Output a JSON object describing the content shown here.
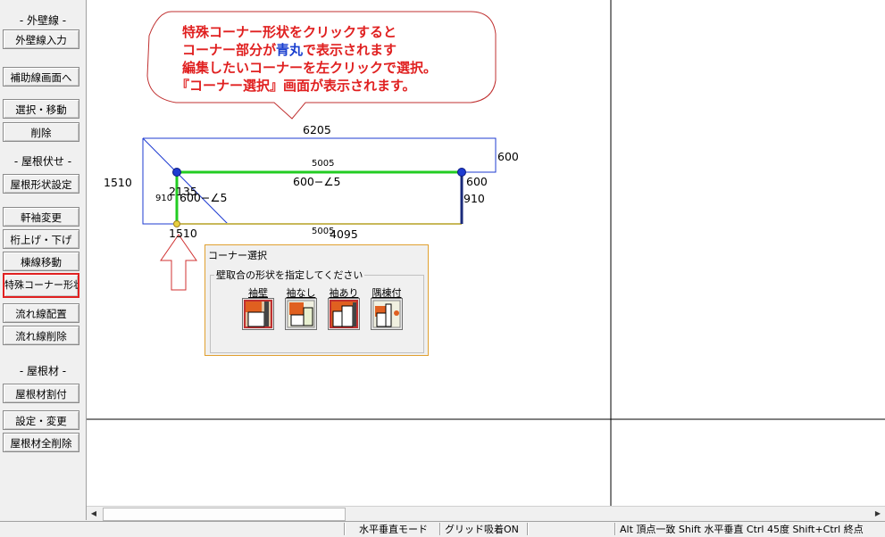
{
  "sidebar": {
    "sections": [
      "- 外壁線 -",
      "- 屋根伏せ -",
      "- 屋根材 -"
    ],
    "buttons": [
      "外壁線入力",
      "補助線画面へ",
      "選択・移動",
      "削除",
      "屋根形状設定",
      "軒袖変更",
      "桁上げ・下げ",
      "棟線移動",
      "特殊コーナー形状",
      "流れ線配置",
      "流れ線削除",
      "屋根材割付",
      "設定・変更",
      "屋根材全削除"
    ]
  },
  "callout": {
    "line1": "特殊コーナー形状をクリックすると",
    "line2_pre": "コーナー部分が",
    "line2_blue": "青丸",
    "line2_post": "で表示されます",
    "line3": "編集したいコーナーを左クリックで選択。",
    "line4": "『コーナー選択』画面が表示されます。"
  },
  "dimensions": {
    "top": "6205",
    "right_upper": "600",
    "left": "1510",
    "inner_top": "5005",
    "inner_mid": "600−∠5",
    "left_2135": "2135",
    "left_910": "910",
    "left_600": "600−∠5",
    "right_600": "600",
    "right_910": "910",
    "bottom_5005": "5005",
    "bottom_4095": "4095",
    "bottom_1510": "1510"
  },
  "dialog": {
    "title": "コーナー選択",
    "group_label": "壁取合の形状を指定してください",
    "options": [
      "袖壁",
      "袖なし",
      "袖あり",
      "隅棟付"
    ]
  },
  "status": {
    "mode": "水平垂直モード",
    "grid": "グリッド吸着ON",
    "hint": "Alt 頂点一致  Shift 水平垂直  Ctrl 45度  Shift+Ctrl 終点"
  },
  "colors": {
    "callout_text": "#e02020",
    "callout_blue": "#1a3fcf",
    "green_line": "#22cc22",
    "blue_line": "#1e3bd1"
  }
}
